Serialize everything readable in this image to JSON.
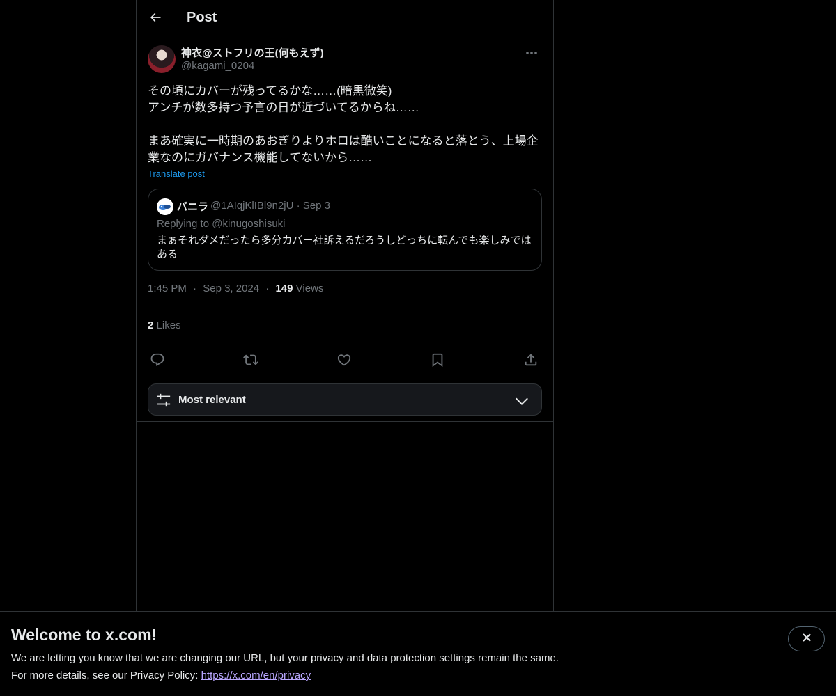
{
  "header": {
    "title": "Post",
    "back_icon": "arrow-left-icon"
  },
  "post": {
    "author": {
      "display_name": "神衣@ストフリの王(何もえず)",
      "handle": "@kagami_0204"
    },
    "text_lines": [
      "その頃にカバーが残ってるかな……(暗黒微笑)",
      "アンチが数多持つ予言の日が近づいてるからね……",
      "まあ確実に一時期のあおぎりよりホロは酷いことになると落とう、上場企業なのにガバナンス機能してないから……"
    ],
    "translate_label": "Translate post",
    "time": "1:45 PM",
    "date": "Sep 3, 2024",
    "views_count": "149",
    "views_label": "Views",
    "likes_count": "2",
    "likes_label": "Likes"
  },
  "quote": {
    "display_name": "バニラ",
    "handle": "@1AIqjKlIBl9n2jU",
    "date": "Sep 3",
    "replying_to": "Replying to @kinugoshisuki",
    "text": "まぁそれダメだったら多分カバー社訴えるだろうしどっちに転んでも楽しみではある"
  },
  "actions": {
    "reply_icon": "reply-icon",
    "repost_icon": "repost-icon",
    "like_icon": "heart-icon",
    "bookmark_icon": "bookmark-icon",
    "share_icon": "share-icon"
  },
  "sort": {
    "label": "Most relevant"
  },
  "banner": {
    "title": "Welcome to x.com!",
    "line1": "We are letting you know that we are changing our URL, but your privacy and data protection settings remain the same.",
    "line2_prefix": "For more details, see our Privacy Policy: ",
    "link_text": "https://x.com/en/privacy"
  },
  "colors": {
    "background": "#000000",
    "text": "#e7e9ea",
    "muted": "#71767b",
    "accent": "#1d9bf0",
    "border": "#2f3336"
  }
}
